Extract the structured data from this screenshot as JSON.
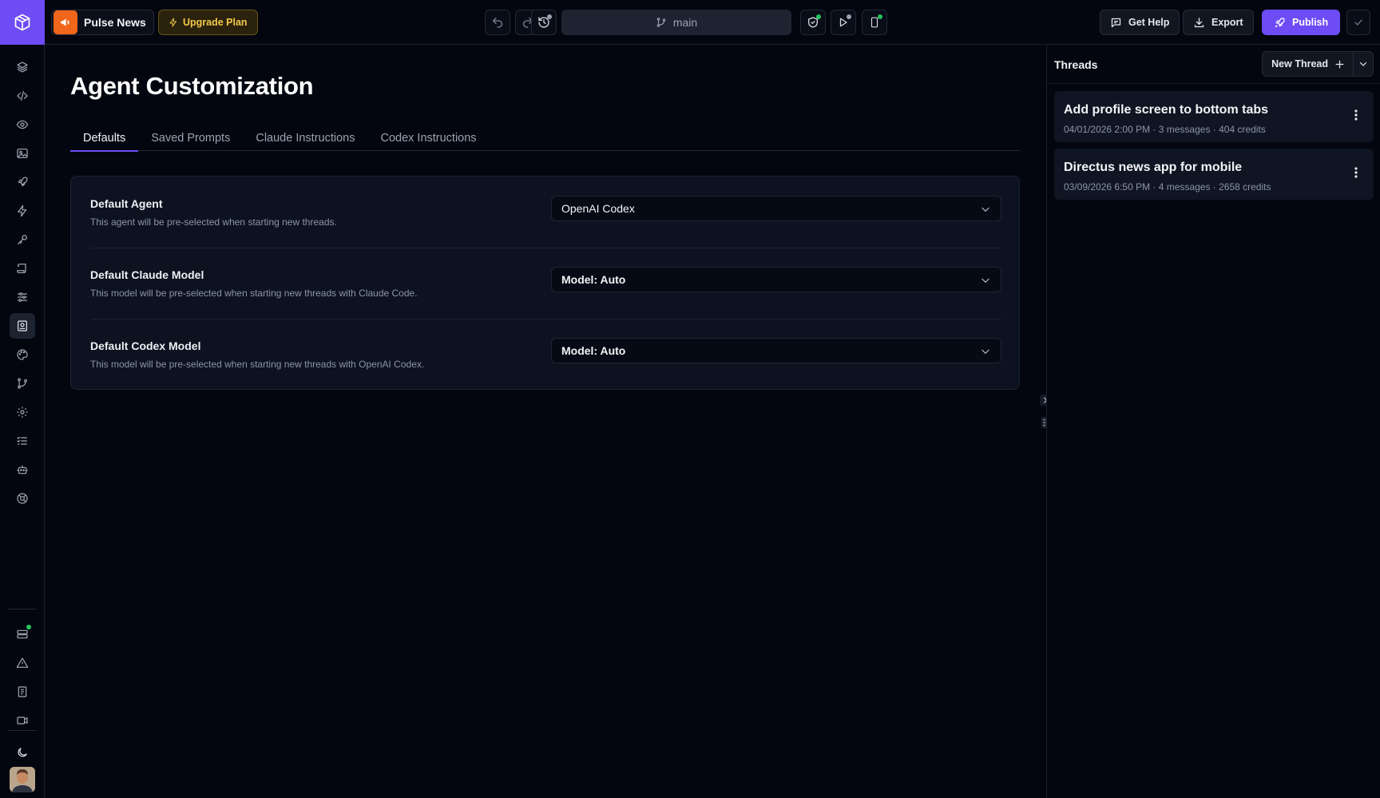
{
  "colors": {
    "accent": "#6d4cf5",
    "project_icon": "#f0661a",
    "upgrade_text": "#f2c94c",
    "status_dot_green": "#22c55e",
    "status_dot_gray": "#9aa2b2"
  },
  "topbar": {
    "logo_icon": "cube-logo-icon",
    "project_name": "Pulse News",
    "upgrade_label": "Upgrade Plan",
    "branch": "main",
    "get_help_label": "Get Help",
    "export_label": "Export",
    "publish_label": "Publish"
  },
  "sidebar": {
    "items": [
      {
        "icon": "layers-icon"
      },
      {
        "icon": "code-icon"
      },
      {
        "icon": "eye-icon"
      },
      {
        "icon": "image-icon"
      },
      {
        "icon": "rocket-icon"
      },
      {
        "icon": "bolt-icon"
      },
      {
        "icon": "key-icon"
      },
      {
        "icon": "scroll-icon"
      },
      {
        "icon": "sliders-icon"
      },
      {
        "icon": "agent-book-icon",
        "active": true
      },
      {
        "icon": "palette-icon"
      },
      {
        "icon": "git-branch-icon"
      },
      {
        "icon": "gear-icon"
      },
      {
        "icon": "checklist-icon"
      },
      {
        "icon": "robot-icon"
      },
      {
        "icon": "support-icon"
      }
    ],
    "bottom_items": [
      {
        "icon": "server-status-icon"
      },
      {
        "icon": "warning-icon"
      },
      {
        "icon": "docs-icon"
      },
      {
        "icon": "video-icon"
      },
      {
        "icon": "moon-icon"
      }
    ]
  },
  "main": {
    "title": "Agent Customization",
    "tabs": [
      {
        "label": "Defaults",
        "active": true
      },
      {
        "label": "Saved Prompts"
      },
      {
        "label": "Claude Instructions"
      },
      {
        "label": "Codex Instructions"
      }
    ],
    "settings": [
      {
        "label": "Default Agent",
        "description": "This agent will be pre-selected when starting new threads.",
        "value": "OpenAI Codex"
      },
      {
        "label": "Default Claude Model",
        "description": "This model will be pre-selected when starting new threads with Claude Code.",
        "value": "Model: Auto"
      },
      {
        "label": "Default Codex Model",
        "description": "This model will be pre-selected when starting new threads with OpenAI Codex.",
        "value": "Model: Auto"
      }
    ]
  },
  "threads": {
    "title": "Threads",
    "new_thread_label": "New Thread",
    "items": [
      {
        "title": "Add profile screen to bottom tabs",
        "meta": "04/01/2026 2:00 PM · 3 messages · 404 credits"
      },
      {
        "title": "Directus news app for mobile",
        "meta": "03/09/2026 6:50 PM · 4 messages · 2658 credits"
      }
    ]
  }
}
